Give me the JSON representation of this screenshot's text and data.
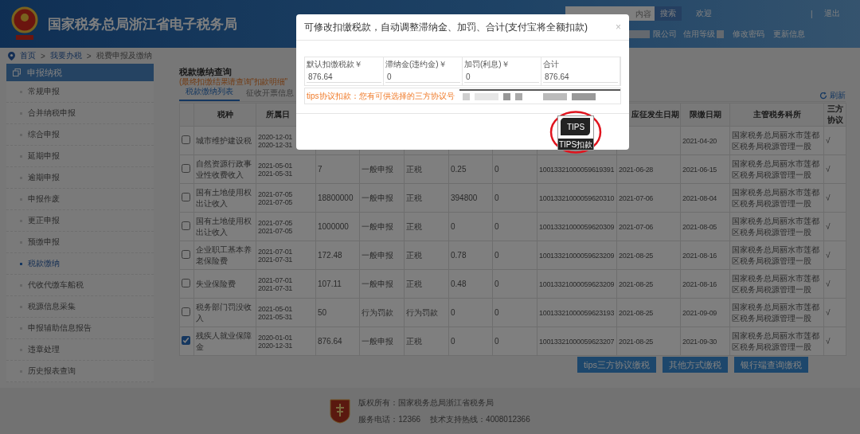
{
  "header": {
    "title": "国家税务总局浙江省电子税务局",
    "search": {
      "placeholder": "内容"
    },
    "search_button": "搜索",
    "welcome": "欢迎",
    "separator": "|",
    "logout": "退出",
    "company": "限公司",
    "credit": "信用等级",
    "links": [
      "修改密码",
      "更新信息"
    ]
  },
  "breadcrumb": {
    "items": [
      "首页",
      "我要办税",
      "税费申报及缴纳"
    ],
    "separator": ">"
  },
  "sidebar": {
    "title": "申报纳税",
    "items": [
      {
        "label": "常规申报",
        "selected": false
      },
      {
        "label": "合并纳税申报",
        "selected": false
      },
      {
        "label": "综合申报",
        "selected": false
      },
      {
        "label": "延期申报",
        "selected": false
      },
      {
        "label": "逾期申报",
        "selected": false
      },
      {
        "label": "申报作废",
        "selected": false
      },
      {
        "label": "更正申报",
        "selected": false
      },
      {
        "label": "预缴申报",
        "selected": false
      },
      {
        "label": "税款缴纳",
        "selected": true
      },
      {
        "label": "代收代缴车船税",
        "selected": false
      },
      {
        "label": "税源信息采集",
        "selected": false
      },
      {
        "label": "申报辅助信息报告",
        "selected": false
      },
      {
        "label": "违章处理",
        "selected": false
      },
      {
        "label": "历史报表查询",
        "selected": false
      }
    ]
  },
  "main": {
    "title": "税款缴纳查询",
    "notice": "(最终扣缴结果请查询\"扣款明细\"",
    "tabs": [
      {
        "label": "税款缴纳列表",
        "selected": true
      },
      {
        "label": "征收开票信息",
        "selected": false
      }
    ],
    "refresh": "刷新"
  },
  "table": {
    "columns": [
      "税种",
      "所属日",
      null,
      null,
      null,
      null,
      null,
      null,
      "应征发生日期",
      "限缴日期",
      "主管税务科所",
      "三方协议"
    ],
    "rows": [
      {
        "checked": false,
        "cells": [
          "城市维护建设税",
          "2020-12-01\n2020-12-31",
          null,
          null,
          null,
          null,
          null,
          null,
          null,
          "2021-04-20",
          "国家税务总局丽水市莲都区税务局税源管理一股",
          "√"
        ]
      },
      {
        "checked": false,
        "cells": [
          "自然资源行政事业性收费收入",
          "2021-05-01\n2021-05-31",
          "7",
          "一般申报",
          "正税",
          "0.25",
          "0",
          "10013321000059619391",
          "2021-06-28",
          "2021-06-15",
          "国家税务总局丽水市莲都区税务局税源管理一股",
          "√"
        ]
      },
      {
        "checked": false,
        "cells": [
          "国有土地使用权出让收入",
          "2021-07-05\n2021-07-05",
          "18800000",
          "一般申报",
          "正税",
          "394800",
          "0",
          "10013321000059620310",
          "2021-07-06",
          "2021-08-04",
          "国家税务总局丽水市莲都区税务局税源管理一股",
          "√"
        ]
      },
      {
        "checked": false,
        "cells": [
          "国有土地使用权出让收入",
          "2021-07-05\n2021-07-05",
          "1000000",
          "一般申报",
          "正税",
          "0",
          "0",
          "10013321000059620309",
          "2021-07-06",
          "2021-08-05",
          "国家税务总局丽水市莲都区税务局税源管理一股",
          "√"
        ]
      },
      {
        "checked": false,
        "cells": [
          "企业职工基本养老保险费",
          "2021-07-01\n2021-07-31",
          "172.48",
          "一般申报",
          "正税",
          "0.78",
          "0",
          "10013321000059623209",
          "2021-08-25",
          "2021-08-16",
          "国家税务总局丽水市莲都区税务局税源管理一股",
          "√"
        ]
      },
      {
        "checked": false,
        "cells": [
          "失业保险费",
          "2021-07-01\n2021-07-31",
          "107.11",
          "一般申报",
          "正税",
          "0.48",
          "0",
          "10013321000059623209",
          "2021-08-25",
          "2021-08-16",
          "国家税务总局丽水市莲都区税务局税源管理一股",
          "√"
        ]
      },
      {
        "checked": false,
        "cells": [
          "税务部门罚没收入",
          "2021-05-01\n2021-05-31",
          "50",
          "行为罚款",
          "行为罚款",
          "0",
          "0",
          "10013321000059623193",
          "2021-08-25",
          "2021-09-09",
          "国家税务总局丽水市莲都区税务局税源管理一股",
          "√"
        ]
      },
      {
        "checked": true,
        "cells": [
          "残疾人就业保障金",
          "2020-01-01\n2020-12-31",
          "876.64",
          "一般申报",
          "正税",
          "0",
          "0",
          "10013321000059623207",
          "2021-08-25",
          "2021-09-30",
          "国家税务总局丽水市莲都区税务局税源管理一股",
          "√"
        ]
      }
    ]
  },
  "buttons": [
    "tips三方协议缴税",
    "其他方式缴税",
    "银行端查询缴税"
  ],
  "footer": {
    "copyright": "版权所有：国家税务总局浙江省税务局",
    "phone": "服务电话：12366",
    "support": "技术支持热线：4008012366"
  },
  "modal": {
    "title": "可修改扣缴税款，自动调整滞纳金、加罚、合计(支付宝将全额扣款)",
    "close": "×",
    "fields": [
      {
        "label": "默认扣缴税款￥",
        "value": "876.64"
      },
      {
        "label": "滞纳金(违约金)￥",
        "value": "0"
      },
      {
        "label": "加罚(利息)￥",
        "value": "0"
      },
      {
        "label": "合计",
        "value": "876.64"
      }
    ],
    "tips_label": "tips协议扣款：您有可供选择的三方协议号",
    "logo": {
      "mark": "TIPS",
      "caption": "TIPS扣款"
    }
  }
}
